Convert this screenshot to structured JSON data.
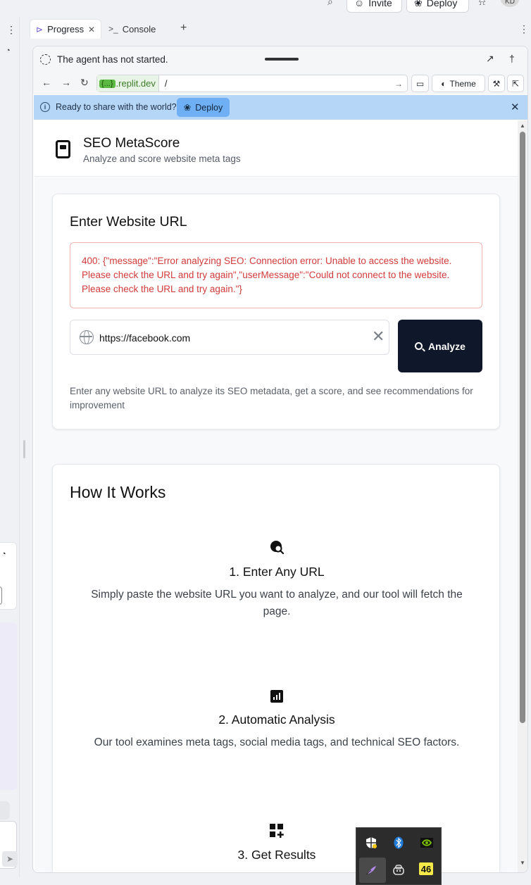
{
  "topbar": {
    "invite_label": "Invite",
    "deploy_label": "Deploy",
    "avatar_initials": "KD"
  },
  "tabs": [
    {
      "label": "Progress",
      "icon": "progress-icon"
    },
    {
      "label": "Console",
      "icon": "terminal-icon"
    }
  ],
  "agent": {
    "status": "The agent has not started."
  },
  "urlbar": {
    "badge": "{...}",
    "host": ".replit.dev",
    "path": "/",
    "theme_label": "Theme"
  },
  "share": {
    "text": "Ready to share with the world?",
    "deploy_label": "Deploy"
  },
  "app": {
    "title": "SEO MetaScore",
    "subtitle": "Analyze and score website meta tags",
    "form": {
      "heading": "Enter Website URL",
      "error": "400: {\"message\":\"Error analyzing SEO: Connection error: Unable to access the website. Please check the URL and try again\",\"userMessage\":\"Could not connect to the website. Please check the URL and try again.\"}",
      "url_value": "https://facebook.com",
      "analyze_label": "Analyze",
      "hint": "Enter any website URL to analyze its SEO metadata, get a score, and see recommendations for improvement"
    },
    "how": {
      "heading": "How It Works",
      "steps": [
        {
          "title": "1. Enter Any URL",
          "desc": "Simply paste the website URL you want to analyze, and our tool will fetch the page.",
          "icon": "globe-search-icon"
        },
        {
          "title": "2. Automatic Analysis",
          "desc": "Our tool examines meta tags, social media tags, and technical SEO factors.",
          "icon": "bar-chart-icon"
        },
        {
          "title": "3. Get Results",
          "desc": "",
          "icon": "grid-add-icon"
        }
      ]
    }
  },
  "tray": {
    "badge_number": "46",
    "icons": [
      "security-icon",
      "bluetooth-icon",
      "nvidia-icon",
      "feather-icon",
      "copilot-icon"
    ]
  }
}
